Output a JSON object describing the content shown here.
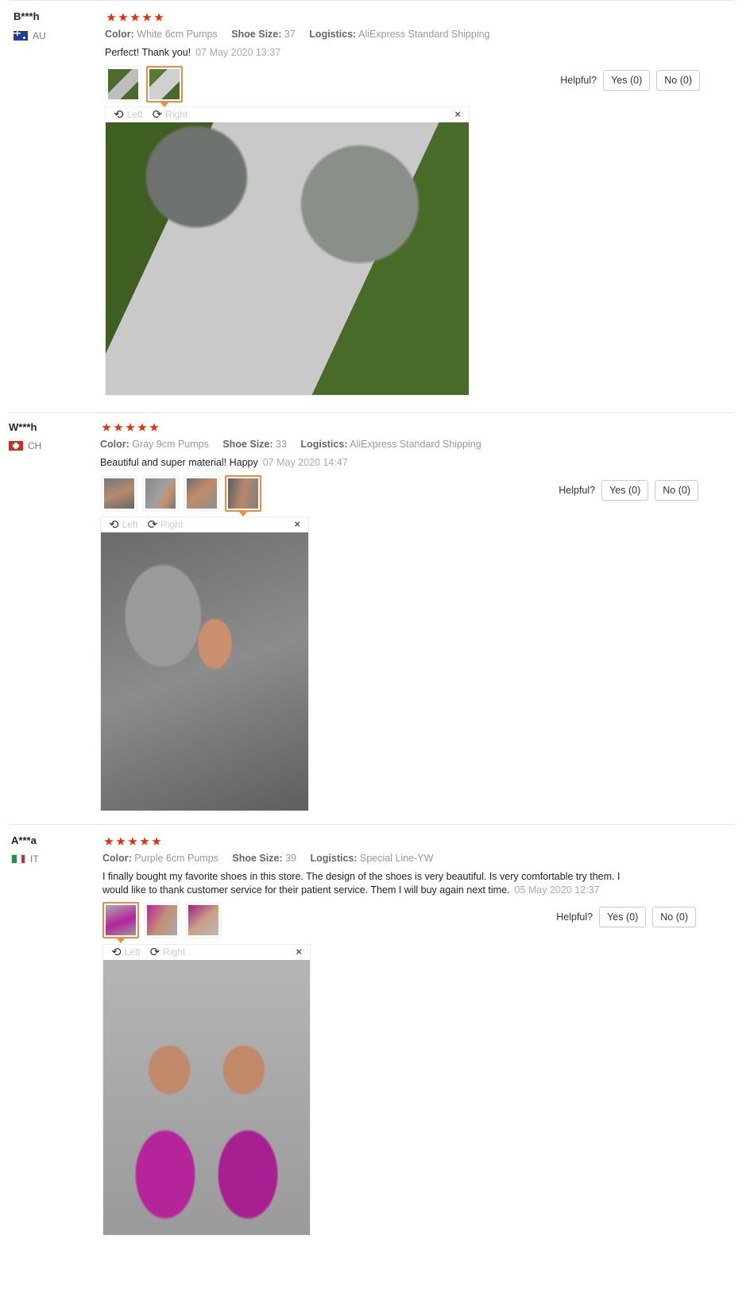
{
  "helpful_label": "Helpful?",
  "viewer": {
    "left_label": "Left",
    "right_label": "Right",
    "close_glyph": "×",
    "rotate_left_glyph": "⟲",
    "rotate_right_glyph": "⟳"
  },
  "star_color": "#e62e04",
  "accent_color": "#f08a3e",
  "reviews": [
    {
      "user": "B***h",
      "country": "AU",
      "rating": 5,
      "color_label": "Color:",
      "color_value": "White 6cm Pumps",
      "size_label": "Shoe Size:",
      "size_value": "37",
      "logistics_label": "Logistics:",
      "logistics_value": "AliExpress Standard Shipping",
      "comment": "Perfect! Thank you!",
      "date": "07 May 2020 13:37",
      "yes_label": "Yes (0)",
      "no_label": "No (0)",
      "photo_count": 2,
      "active_photo": 2
    },
    {
      "user": "W***h",
      "country": "CH",
      "rating": 5,
      "color_label": "Color:",
      "color_value": "Gray 9cm Pumps",
      "size_label": "Shoe Size:",
      "size_value": "33",
      "logistics_label": "Logistics:",
      "logistics_value": "AliExpress Standard Shipping",
      "comment": "Beautiful and super material! Happy",
      "date": "07 May 2020 14:47",
      "yes_label": "Yes (0)",
      "no_label": "No (0)",
      "photo_count": 4,
      "active_photo": 4
    },
    {
      "user": "A***a",
      "country": "IT",
      "rating": 5,
      "color_label": "Color:",
      "color_value": "Purple 6cm Pumps",
      "size_label": "Shoe Size:",
      "size_value": "39",
      "logistics_label": "Logistics:",
      "logistics_value": "Special Line-YW",
      "comment": "I finally bought my favorite shoes in this store. The design of the shoes is very beautiful. Is very comfortable try them. I would like to thank customer service for their patient service. Them I will buy again next time.",
      "date": "05 May 2020 12:37",
      "yes_label": "Yes (0)",
      "no_label": "No (0)",
      "photo_count": 3,
      "active_photo": 1
    }
  ]
}
